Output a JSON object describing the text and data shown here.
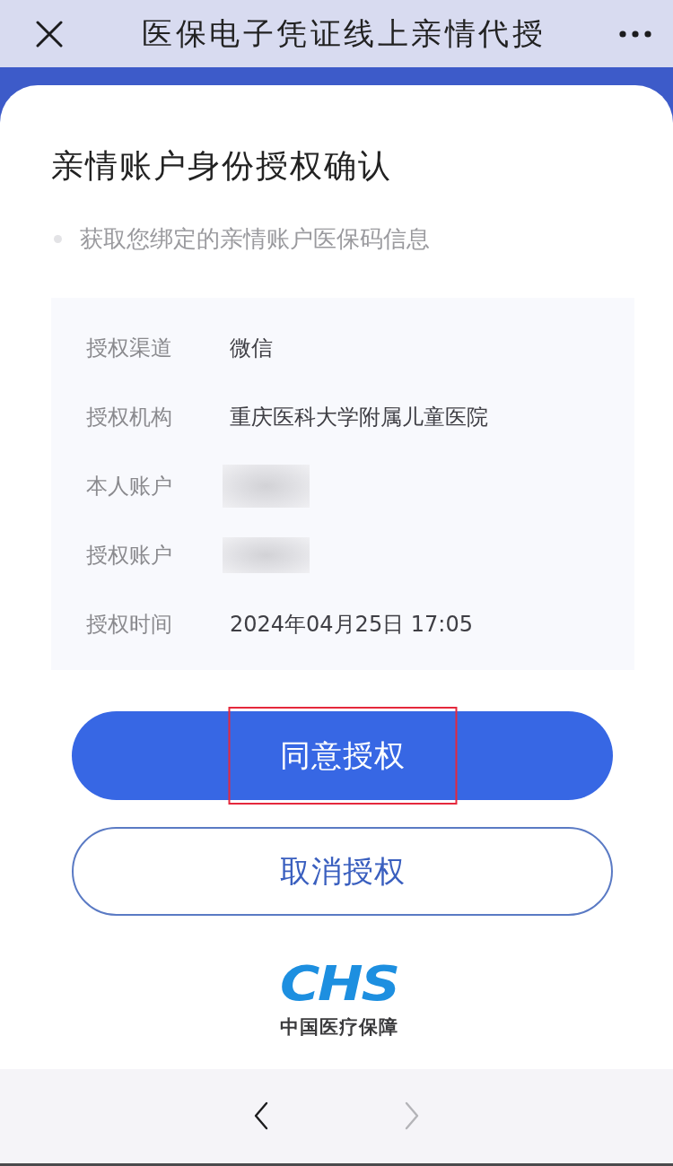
{
  "top_bar": {
    "title": "医保电子凭证线上亲情代授"
  },
  "card": {
    "heading": "亲情账户身份授权确认",
    "scope_items": [
      "获取您绑定的亲情账户医保码信息"
    ]
  },
  "details": [
    {
      "kind": "text",
      "label": "授权渠道",
      "value": "微信"
    },
    {
      "kind": "text",
      "label": "授权机构",
      "value": "重庆医科大学附属儿童医院"
    },
    {
      "kind": "redacted",
      "label": "本人账户"
    },
    {
      "kind": "redacted",
      "label": "授权账户"
    },
    {
      "kind": "text",
      "label": "授权时间",
      "value": "2024年04月25日 17:05"
    }
  ],
  "buttons": [
    {
      "kind": "primary",
      "label": "同意授权",
      "highlighted": true
    },
    {
      "kind": "outline",
      "label": "取消授权",
      "highlighted": false
    }
  ],
  "logo": {
    "mark": "CHS",
    "name": "中国医疗保障"
  },
  "nav_bar": {
    "back": {
      "disabled": false
    },
    "forward": {
      "disabled": true
    }
  }
}
